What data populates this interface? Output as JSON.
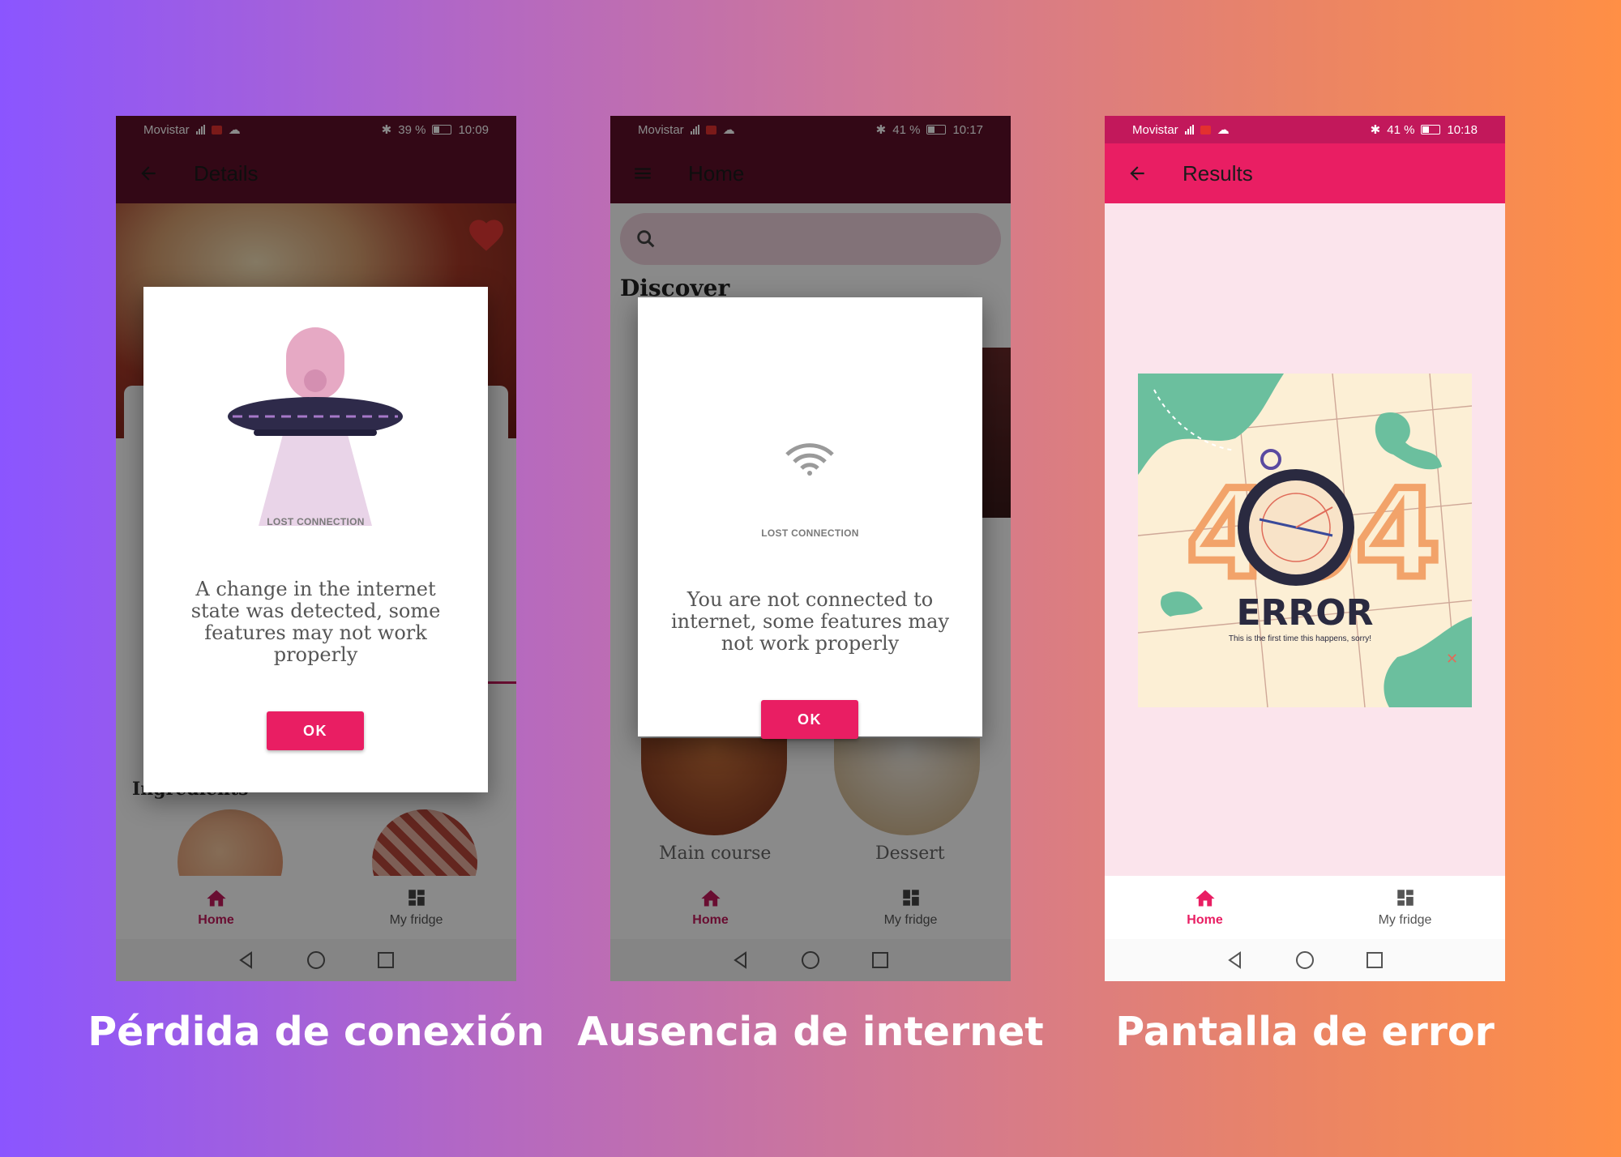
{
  "colors": {
    "dark_bar": "#5e0f2a",
    "status_bar_pink": "#c2185b",
    "app_bar_pink": "#e91e63",
    "accent": "#e91e63",
    "error_bg": "#fbe4ec"
  },
  "screens": [
    {
      "status": {
        "carrier": "Movistar",
        "battery": "39 %",
        "time": "10:09"
      },
      "app_bar": {
        "nav_icon": "arrow-back-icon",
        "title": "Details"
      },
      "background_text": {
        "ingredients": "Ingredients"
      },
      "dialog": {
        "image_label": "LOST CONNECTION",
        "message": "A change in the internet state was detected, some features may not work properly",
        "ok": "OK"
      },
      "bottom_nav": {
        "home": "Home",
        "fridge": "My fridge"
      },
      "caption": "Pérdida de conexión"
    },
    {
      "status": {
        "carrier": "Movistar",
        "battery": "41 %",
        "time": "10:17"
      },
      "app_bar": {
        "nav_icon": "menu-icon",
        "title": "Home"
      },
      "background_text": {
        "discover": "Discover",
        "main_course": "Main course",
        "dessert": "Dessert"
      },
      "dialog": {
        "image_label": "LOST CONNECTION",
        "message": "You are not connected to internet, some features may not work properly",
        "ok": "OK"
      },
      "bottom_nav": {
        "home": "Home",
        "fridge": "My fridge"
      },
      "caption": "Ausencia de internet"
    },
    {
      "status": {
        "carrier": "Movistar",
        "battery": "41 %",
        "time": "10:18"
      },
      "app_bar": {
        "nav_icon": "arrow-back-icon",
        "title": "Results"
      },
      "error": {
        "digits": "404",
        "heading": "ERROR",
        "sub": "This is the first time this happens, sorry!"
      },
      "bottom_nav": {
        "home": "Home",
        "fridge": "My fridge"
      },
      "caption": "Pantalla de error"
    }
  ]
}
